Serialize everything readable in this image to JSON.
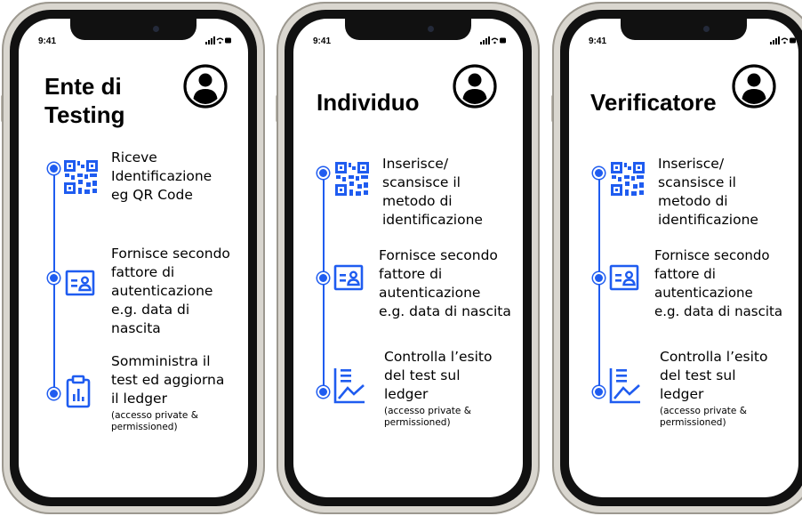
{
  "status_time": "9:41",
  "phones": [
    {
      "title_lines": [
        "Ente di",
        "Testing"
      ],
      "steps": [
        {
          "lines": [
            "Riceve",
            "Identificazione",
            "eg QR Code"
          ],
          "note_lines": []
        },
        {
          "lines": [
            "Fornisce secondo",
            "fattore di",
            "autenticazione",
            "e.g. data di",
            "nascita"
          ],
          "note_lines": []
        },
        {
          "lines": [
            "Somministra il",
            "test ed aggiorna",
            "il ledger"
          ],
          "note_lines": [
            "(accesso private &",
            "permissioned)"
          ]
        }
      ]
    },
    {
      "title_lines": [
        "Individuo"
      ],
      "steps": [
        {
          "lines": [
            "Inserisce/",
            "scansisce il",
            "metodo di",
            "identificazione"
          ],
          "note_lines": []
        },
        {
          "lines": [
            "Fornisce secondo",
            "fattore di",
            "autenticazione",
            "e.g. data di nascita"
          ],
          "note_lines": []
        },
        {
          "lines": [
            "Controlla l’esito",
            "del test sul",
            "ledger"
          ],
          "note_lines": [
            "(accesso private &",
            "permissioned)"
          ]
        }
      ]
    },
    {
      "title_lines": [
        "Verificatore"
      ],
      "steps": [
        {
          "lines": [
            "Inserisce/",
            "scansisce il",
            "metodo di",
            "identificazione"
          ],
          "note_lines": []
        },
        {
          "lines": [
            "Fornisce secondo",
            "fattore di",
            "autenticazione",
            "e.g. data di nascita"
          ],
          "note_lines": []
        },
        {
          "lines": [
            "Controlla l’esito",
            "del test sul",
            "ledger"
          ],
          "note_lines": [
            "(accesso private &",
            "permissioned)"
          ]
        }
      ]
    }
  ],
  "colors": {
    "accent": "#1f5cf0",
    "frame": "#d9d6cf",
    "bezel": "#111111"
  },
  "icons": [
    "qr-code-icon",
    "id-card-icon",
    "clipboard-chart-icon",
    "document-trend-icon",
    "user-avatar-icon"
  ]
}
